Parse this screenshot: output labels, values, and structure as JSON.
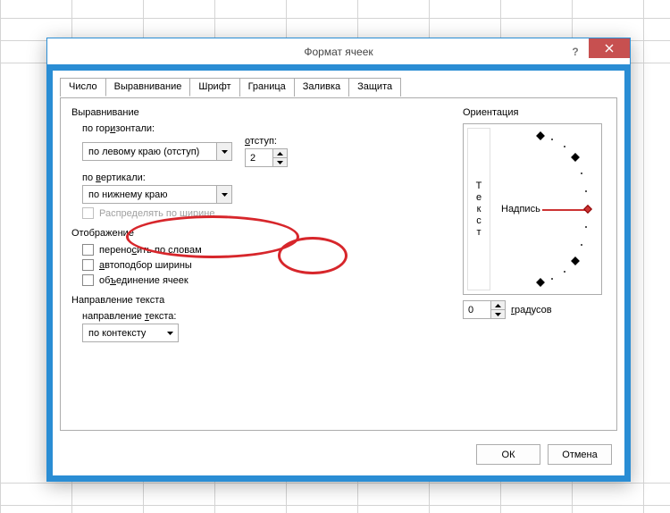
{
  "dialog": {
    "title": "Формат ячеек",
    "help": "?",
    "tabs": [
      "Число",
      "Выравнивание",
      "Шрифт",
      "Граница",
      "Заливка",
      "Защита"
    ],
    "active_tab": 1
  },
  "alignment": {
    "group_label": "Выравнивание",
    "horizontal_label": "по горизонтали:",
    "horizontal_value": "по левому краю (отступ)",
    "indent_label": "отступ:",
    "indent_value": "2",
    "vertical_label": "по вертикали:",
    "vertical_value": "по нижнему краю",
    "justify_distributed_label": "Распределять по ширине"
  },
  "display": {
    "group_label": "Отображение",
    "wrap_text_label": "переносить по словам",
    "shrink_label": "автоподбор ширины",
    "merge_label": "объединение ячеек"
  },
  "direction": {
    "group_label": "Направление текста",
    "field_label": "направление текста:",
    "value": "по контексту"
  },
  "orientation": {
    "group_label": "Ориентация",
    "vertical_text": "Текст",
    "label_center": "Надпись",
    "degrees_value": "0",
    "degrees_label": "градусов"
  },
  "footer": {
    "ok": "ОК",
    "cancel": "Отмена"
  },
  "chart_data": null
}
